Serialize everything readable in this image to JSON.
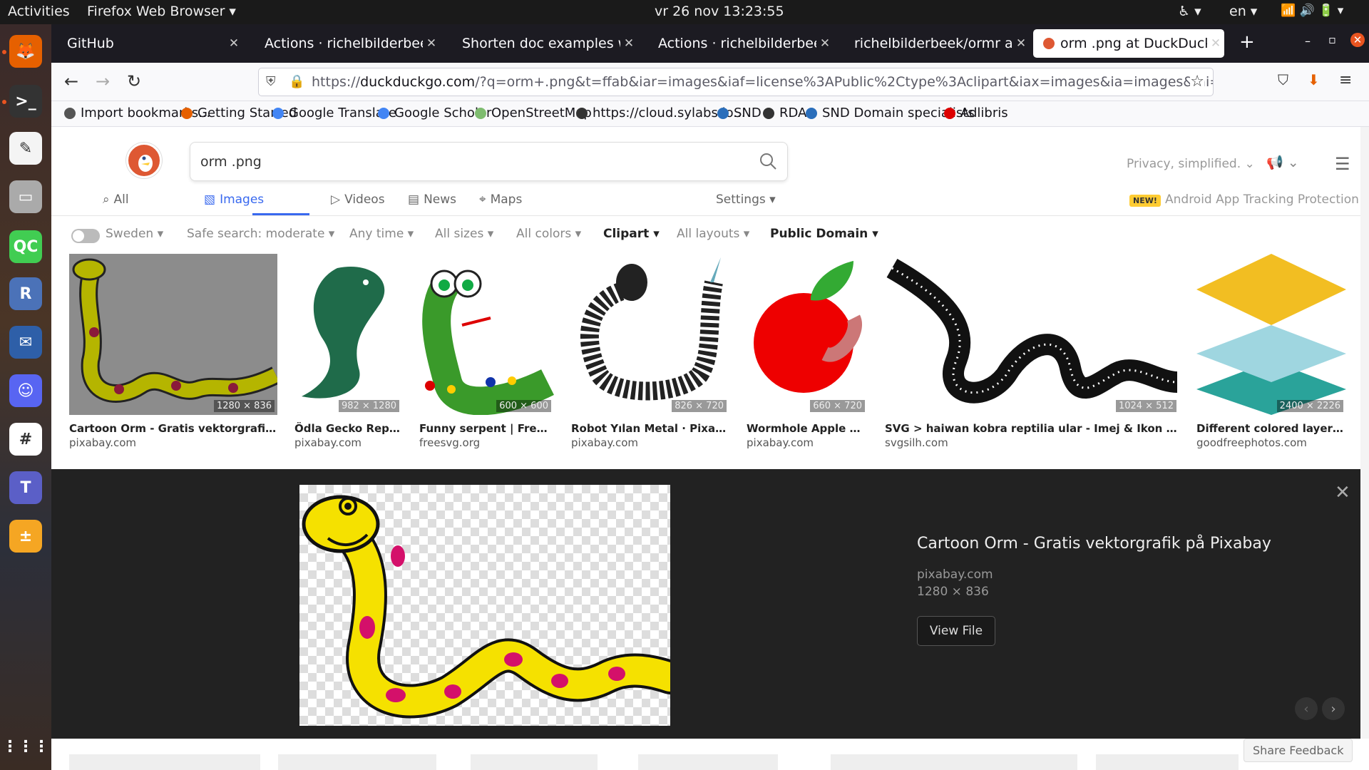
{
  "topbar": {
    "activities": "Activities",
    "app": "Firefox Web Browser ▾",
    "clock": "vr 26 nov  13:23:55",
    "lang": "en ▾",
    "accessibility": "♿ ▾",
    "status": "📶 🔊 🔋 ▾"
  },
  "dock": {
    "items": [
      {
        "name": "firefox-icon",
        "bg": "#e66000",
        "glyph": "🦊"
      },
      {
        "name": "terminal-icon",
        "bg": "#333",
        "glyph": ">_"
      },
      {
        "name": "text-editor-icon",
        "bg": "#f4f4f4",
        "glyph": "✎"
      },
      {
        "name": "files-icon",
        "bg": "#aaa",
        "glyph": "▭"
      },
      {
        "name": "qtcreator-icon",
        "bg": "#41cd52",
        "glyph": "QC"
      },
      {
        "name": "r-icon",
        "bg": "#4b72b8",
        "glyph": "R"
      },
      {
        "name": "thunderbird-icon",
        "bg": "#2e5fa8",
        "glyph": "✉"
      },
      {
        "name": "discord-icon",
        "bg": "#5865f2",
        "glyph": "☺"
      },
      {
        "name": "slack-icon",
        "bg": "#fff",
        "glyph": "#"
      },
      {
        "name": "teams-icon",
        "bg": "#5b5fc7",
        "glyph": "T"
      },
      {
        "name": "calculator-icon",
        "bg": "#f5a623",
        "glyph": "±"
      }
    ],
    "apps_grid": "⋮⋮⋮"
  },
  "tabs": [
    {
      "label": "GitHub"
    },
    {
      "label": "Actions · richelbilderbeek"
    },
    {
      "label": "Shorten doc examples w"
    },
    {
      "label": "Actions · richelbilderbeek"
    },
    {
      "label": "richelbilderbeek/ormr at"
    },
    {
      "label": "orm .png at DuckDuckGo"
    }
  ],
  "tabbar": {
    "new_tab": "+",
    "minimize": "–",
    "restore": "▫",
    "close": "✕"
  },
  "navbar": {
    "back": "←",
    "forward": "→",
    "reload": "↻",
    "url_prefix": "https://",
    "url_domain": "duckduckgo.com",
    "url_rest": "/?q=orm+.png&t=ffab&iar=images&iaf=license%3APublic%2Ctype%3Aclipart&iax=images&ia=images&iai=ht",
    "star": "☆",
    "pocket": "⛉",
    "download": "⬇",
    "menu": "≡"
  },
  "bookmarks": [
    {
      "label": "Import bookmarks...",
      "color": "#555"
    },
    {
      "label": "Getting Started",
      "color": "#e66000"
    },
    {
      "label": "Google Translate",
      "color": "#4285f4"
    },
    {
      "label": "Google Scholar",
      "color": "#4285f4"
    },
    {
      "label": "OpenStreetMap",
      "color": "#7ebc6f"
    },
    {
      "label": "https://cloud.sylabs.io...",
      "color": "#333"
    },
    {
      "label": "SND",
      "color": "#2a6ebb"
    },
    {
      "label": "RDA",
      "color": "#333"
    },
    {
      "label": "SND Domain specialists",
      "color": "#2a6ebb"
    },
    {
      "label": "Adlibris",
      "color": "#d00"
    }
  ],
  "search": {
    "query": "orm .png"
  },
  "header": {
    "privacy": "Privacy, simplified. ⌄",
    "hamburger": "☰",
    "megaphone": "📢 ⌄"
  },
  "verticals": [
    {
      "label": "All",
      "icon": "⌕"
    },
    {
      "label": "Images",
      "icon": "▧"
    },
    {
      "label": "Videos",
      "icon": "▷"
    },
    {
      "label": "News",
      "icon": "▤"
    },
    {
      "label": "Maps",
      "icon": "⌖"
    }
  ],
  "settings_label": "Settings ▾",
  "new_badge": "NEW!",
  "app_protection": "Android App Tracking Protection",
  "filters": {
    "region": "Sweden ▾",
    "safe": "Safe search: moderate ▾",
    "time": "Any time ▾",
    "size": "All sizes ▾",
    "color": "All colors ▾",
    "type": "Clipart ▾",
    "layout": "All layouts ▾",
    "license": "Public Domain ▾"
  },
  "results": [
    {
      "title": "Cartoon Orm - Gratis vektorgrafik på ...",
      "source": "pixabay.com",
      "dims": "1280 × 836"
    },
    {
      "title": "Ödla Gecko Reptil ...",
      "source": "pixabay.com",
      "dims": "982 × 1280"
    },
    {
      "title": "Funny serpent | Free SVG",
      "source": "freesvg.org",
      "dims": "600 × 600"
    },
    {
      "title": "Robot Yılan Metal · Pixabay'...",
      "source": "pixabay.com",
      "dims": "826 × 720"
    },
    {
      "title": "Wormhole Apple Wor...",
      "source": "pixabay.com",
      "dims": "660 × 720"
    },
    {
      "title": "SVG > haiwan kobra reptilia ular - Imej & Ikon SVG Per...",
      "source": "svgsilh.com",
      "dims": "1024 × 512"
    },
    {
      "title": "Different colored layers ve...",
      "source": "goodfreephotos.com",
      "dims": "2400 × 2226"
    }
  ],
  "detail": {
    "title": "Cartoon Orm - Gratis vektorgrafik på Pixabay",
    "source": "pixabay.com",
    "size": "1280 × 836",
    "view_file": "View File",
    "close": "✕",
    "prev": "‹",
    "next": "›"
  },
  "feedback": "Share Feedback"
}
